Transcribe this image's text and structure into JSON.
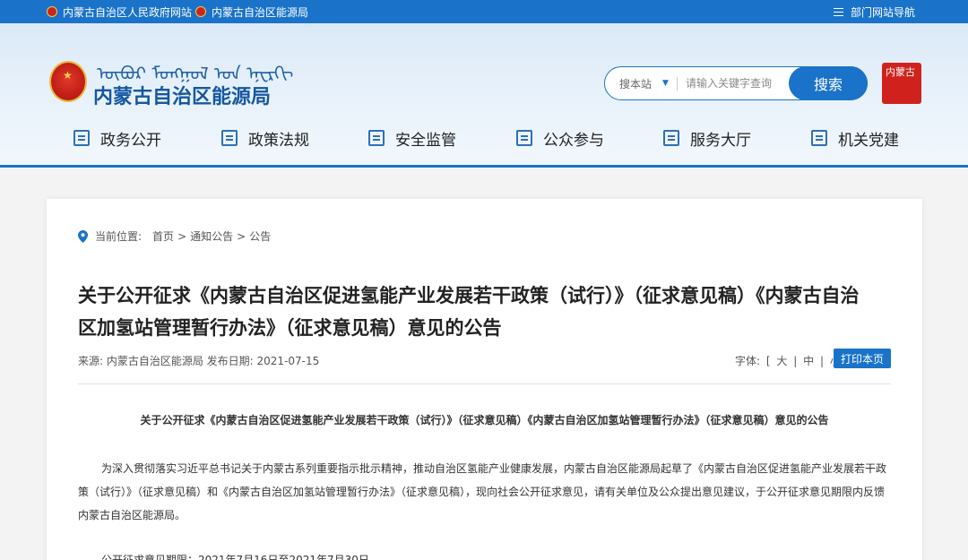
{
  "topbar": {
    "link1": "内蒙古自治区人民政府网站",
    "link2": "内蒙古自治区能源局",
    "dept_nav": "部门网站导航"
  },
  "header": {
    "mongolian_script": "ᠦᠪᠦᠷ ᠮᠣᠩᠭᠣᠯ ᠤᠨ ᠡᠨᠧᠷᠭᠢ",
    "site_title": "内蒙古自治区能源局",
    "seal_text": "内蒙古"
  },
  "search": {
    "scope": "搜本站",
    "placeholder": "请输入关键字查询",
    "button": "搜索"
  },
  "nav": [
    {
      "label": "政务公开"
    },
    {
      "label": "政策法规"
    },
    {
      "label": "安全监管"
    },
    {
      "label": "公众参与"
    },
    {
      "label": "服务大厅"
    },
    {
      "label": "机关党建"
    }
  ],
  "breadcrumb": {
    "prefix": "当前位置:",
    "home": "首页",
    "sep": ">",
    "level1": "通知公告",
    "level2": "公告"
  },
  "article": {
    "title": "关于公开征求《内蒙古自治区促进氢能产业发展若干政策（试行）》（征求意见稿）《内蒙古自治区加氢站管理暂行办法》（征求意见稿）意见的公告",
    "meta": "来源:  内蒙古自治区能源局 发布日期:  2021-07-15",
    "font_label": "字体:",
    "font_open": "[",
    "font_large": "大",
    "font_bar": "|",
    "font_medium": "中",
    "font_small": "小",
    "font_close": "]",
    "print_button": "打印本页",
    "subtitle": "关于公开征求《内蒙古自治区促进氢能产业发展若干政策（试行）》（征求意见稿）《内蒙古自治区加氢站管理暂行办法》（征求意见稿）意见的公告",
    "paragraph1": "为深入贯彻落实习近平总书记关于内蒙古系列重要指示批示精神，推动自治区氢能产业健康发展，内蒙古自治区能源局起草了《内蒙古自治区促进氢能产业发展若干政策（试行）》（征求意见稿）和《内蒙古自治区加氢站管理暂行办法》（征求意见稿），现向社会公开征求意见，请有关单位及公众提出意见建议，于公开征求意见期限内反馈内蒙古自治区能源局。",
    "paragraph2": "公开征求意见期限：2021年7月16日至2021年7月30日"
  },
  "colors": {
    "primary": "#1a73c9",
    "title_blue": "#1557a0",
    "seal_red": "#d0221c"
  }
}
